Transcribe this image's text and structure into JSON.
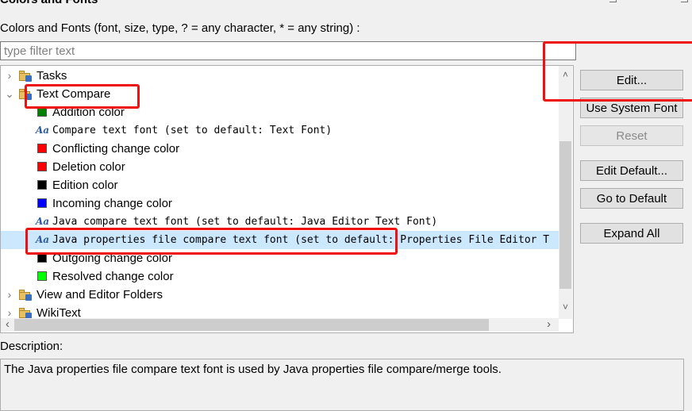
{
  "page": {
    "title": "Colors and Fonts",
    "intro": "Colors and Fonts (font, size, type, ? = any character, * = any string) :",
    "filter_placeholder": "type filter text",
    "description_label": "Description:",
    "description_text": "The Java properties file compare text font is used by Java properties file compare/merge tools."
  },
  "tree": [
    {
      "kind": "folder",
      "label": "Tasks",
      "expanded": false
    },
    {
      "kind": "folder",
      "label": "Text Compare",
      "expanded": true
    },
    {
      "kind": "color",
      "label": "Addition color",
      "color": "#008000"
    },
    {
      "kind": "font",
      "label": "Compare text font (set to default: Text Font)"
    },
    {
      "kind": "color",
      "label": "Conflicting change color",
      "color": "#ff0000"
    },
    {
      "kind": "color",
      "label": "Deletion color",
      "color": "#ff0000"
    },
    {
      "kind": "color",
      "label": "Edition color",
      "color": "#000000"
    },
    {
      "kind": "color",
      "label": "Incoming change color",
      "color": "#0000ff"
    },
    {
      "kind": "font",
      "label": "Java compare text font (set to default: Java Editor Text Font)"
    },
    {
      "kind": "font",
      "label": "Java properties file compare text font (set to default: Properties File Editor T",
      "selected": true
    },
    {
      "kind": "color",
      "label": "Outgoing change color",
      "color": "#000000"
    },
    {
      "kind": "color",
      "label": "Resolved change color",
      "color": "#00ff00"
    },
    {
      "kind": "folder",
      "label": "View and Editor Folders",
      "expanded": false
    },
    {
      "kind": "folder",
      "label": "WikiText",
      "expanded": false
    }
  ],
  "buttons": {
    "edit": "Edit...",
    "use_system_font": "Use System Font",
    "reset": "Reset",
    "edit_default": "Edit Default...",
    "go_to_default": "Go to Default",
    "expand_all": "Expand All"
  },
  "icons": {
    "expand_closed": "›",
    "expand_open": "⌄",
    "font_icon": "Aa",
    "scroll_up": "˄",
    "scroll_down": "˅",
    "scroll_left": "‹",
    "scroll_right": "›"
  },
  "colors": {
    "selection": "#cce8ff",
    "annotation": "#ee1111"
  }
}
